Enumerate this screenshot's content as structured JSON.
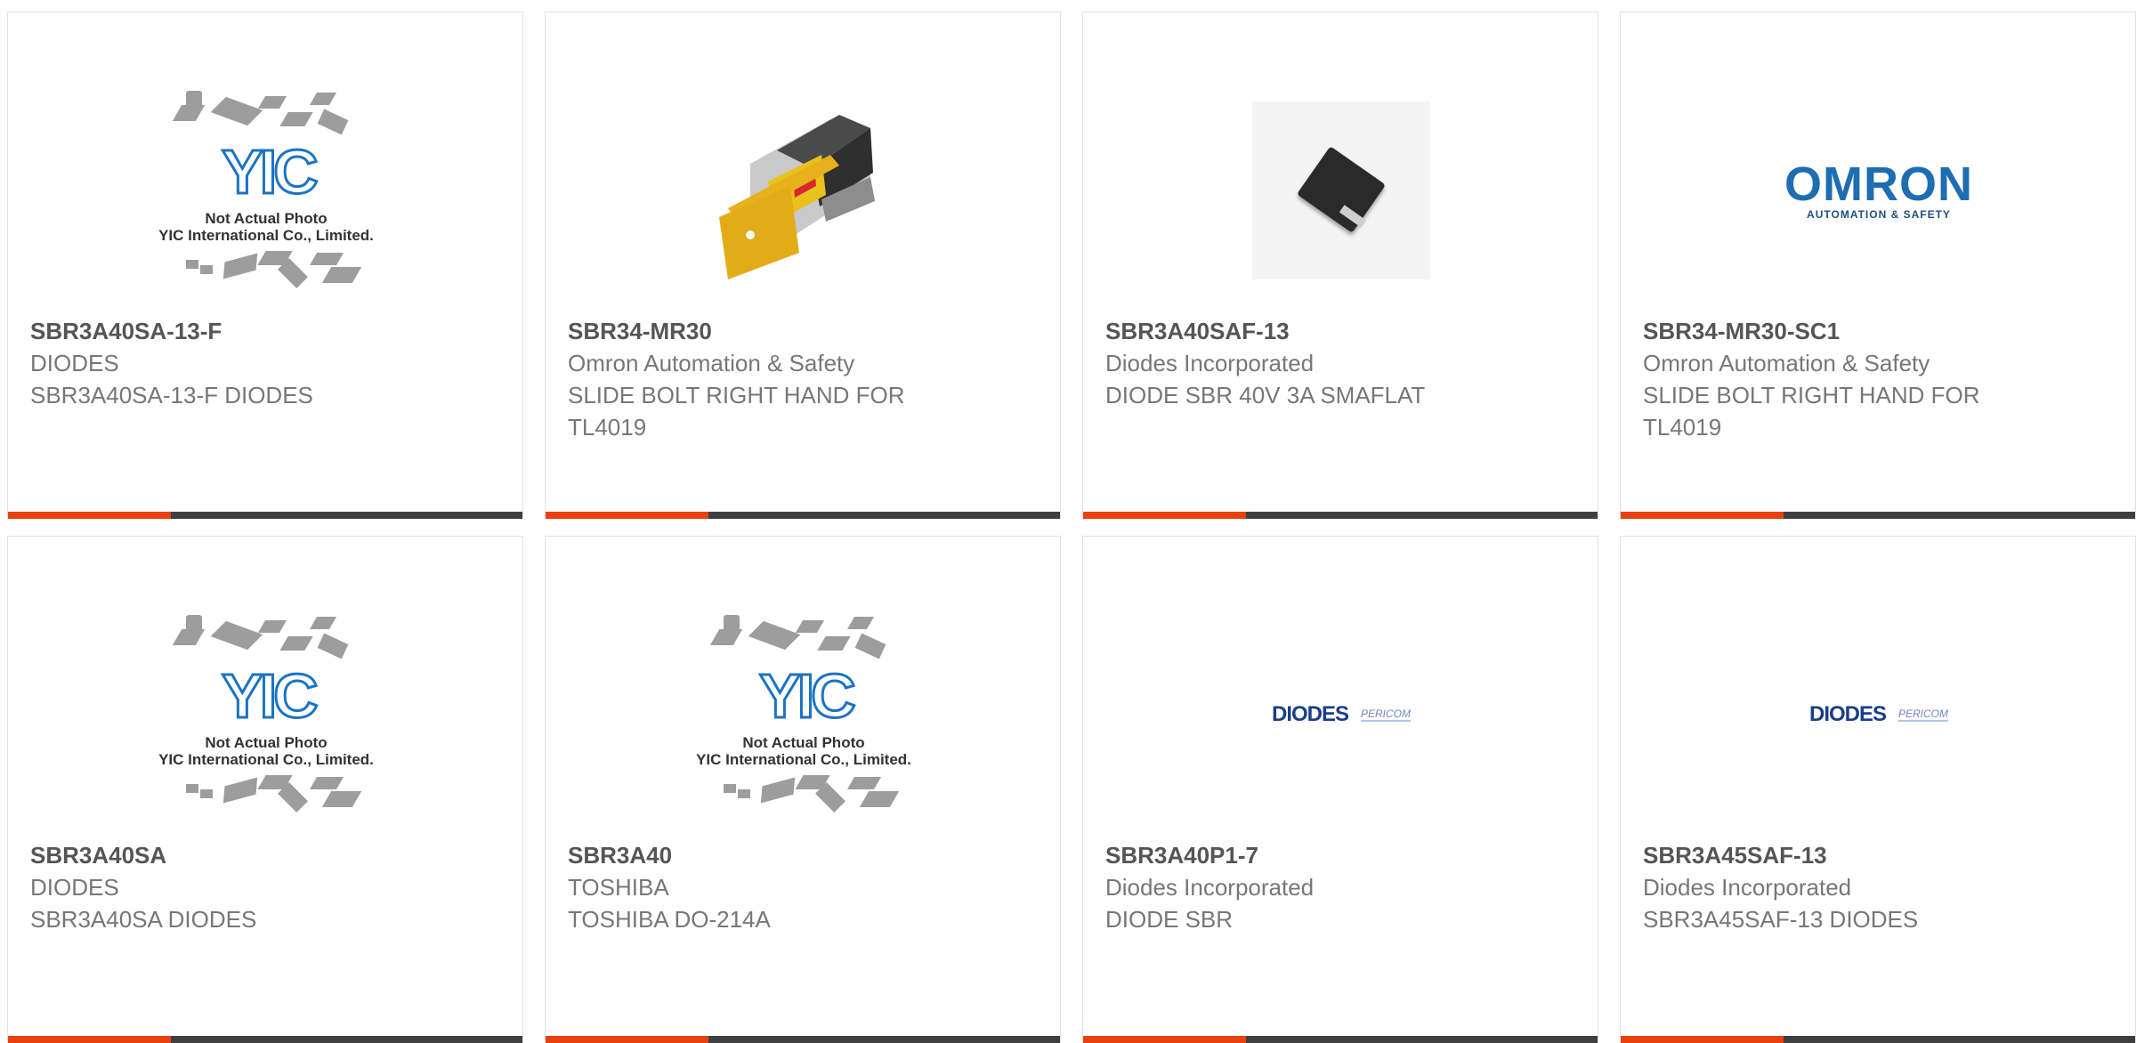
{
  "products": [
    {
      "part_number": "SBR3A40SA-13-F",
      "manufacturer": "DIODES",
      "description": "SBR3A40SA-13-F DIODES",
      "image": "yic-placeholder",
      "image_text": [
        "Not Actual Photo",
        "YIC International Co., Limited."
      ],
      "logo_text": "YIC"
    },
    {
      "part_number": "SBR34-MR30",
      "manufacturer": "Omron Automation & Safety",
      "description": "SLIDE BOLT RIGHT HAND FOR TL4019",
      "image": "slide-bolt-photo"
    },
    {
      "part_number": "SBR3A40SAF-13",
      "manufacturer": "Diodes Incorporated",
      "description": "DIODE SBR 40V 3A SMAFLAT",
      "image": "diode-package-photo"
    },
    {
      "part_number": "SBR34-MR30-SC1",
      "manufacturer": "Omron Automation & Safety",
      "description": "SLIDE BOLT RIGHT HAND FOR TL4019",
      "image": "omron-logo",
      "logo_text": "OMRON",
      "logo_subtext": "AUTOMATION & SAFETY"
    },
    {
      "part_number": "SBR3A40SA",
      "manufacturer": "DIODES",
      "description": "SBR3A40SA DIODES",
      "image": "yic-placeholder",
      "image_text": [
        "Not Actual Photo",
        "YIC International Co., Limited."
      ],
      "logo_text": "YIC"
    },
    {
      "part_number": "SBR3A40",
      "manufacturer": "TOSHIBA",
      "description": "TOSHIBA DO-214A",
      "image": "yic-placeholder",
      "image_text": [
        "Not Actual Photo",
        "YIC International Co., Limited."
      ],
      "logo_text": "YIC"
    },
    {
      "part_number": "SBR3A40P1-7",
      "manufacturer": "Diodes Incorporated",
      "description": "DIODE SBR",
      "image": "diodes-pericom-logo",
      "logo_text": "DIODES",
      "logo_subtext": "PERICOM"
    },
    {
      "part_number": "SBR3A45SAF-13",
      "manufacturer": "Diodes Incorporated",
      "description": "SBR3A45SAF-13 DIODES",
      "image": "diodes-pericom-logo",
      "logo_text": "DIODES",
      "logo_subtext": "PERICOM"
    }
  ],
  "colors": {
    "accent": "#e8410d",
    "bar": "#3f3f3f",
    "part_number": "#555555",
    "text": "#777777",
    "yic_blue": "#1b73c4",
    "omron_blue": "#1d6db3",
    "diodes_navy": "#1a3f86"
  }
}
